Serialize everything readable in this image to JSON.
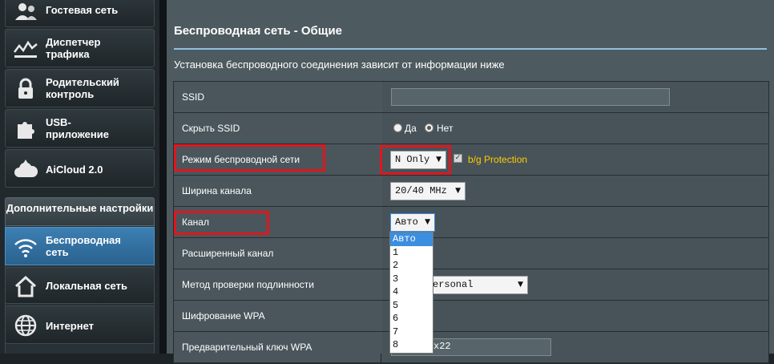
{
  "sidebar": {
    "items": [
      {
        "label": "Гостевая сеть",
        "icon": "guest-network-icon"
      },
      {
        "label": "Диспетчер трафика",
        "icon": "traffic-manager-icon"
      },
      {
        "label": "Родительский контроль",
        "icon": "lock-icon"
      },
      {
        "label": "USB-приложение",
        "icon": "puzzle-icon"
      },
      {
        "label": "AiCloud 2.0",
        "icon": "cloud-icon"
      }
    ],
    "advanced_header": "Дополнительные настройки",
    "advanced_items": [
      {
        "label": "Беспроводная сеть",
        "icon": "wifi-icon",
        "active": true
      },
      {
        "label": "Локальная сеть",
        "icon": "home-icon"
      },
      {
        "label": "Интернет",
        "icon": "globe-icon"
      }
    ]
  },
  "main": {
    "title": "Беспроводная сеть - Общие",
    "description": "Установка беспроводного соединения зависит от информации ниже",
    "fields": {
      "ssid": {
        "label": "SSID",
        "value": ""
      },
      "hide_ssid": {
        "label": "Скрыть SSID",
        "options": [
          "Да",
          "Нет"
        ],
        "selected": "Нет"
      },
      "wireless_mode": {
        "label": "Режим беспроводной сети",
        "value": "N Only",
        "protection_label": "b/g Protection",
        "protection_checked": true
      },
      "channel_width": {
        "label": "Ширина канала",
        "value": "20/40 MHz"
      },
      "channel": {
        "label": "Канал",
        "value": "Авто",
        "options": [
          "Авто",
          "1",
          "2",
          "3",
          "4",
          "5",
          "6",
          "7",
          "8"
        ],
        "selected": "Авто"
      },
      "extended_channel": {
        "label": "Расширенный канал"
      },
      "auth_method": {
        "label": "Метод проверки подлинности",
        "value_visible": "ersonal"
      },
      "wpa_encryption": {
        "label": "Шифрование WPA"
      },
      "wpa_key": {
        "label": "Предварительный ключ WPA",
        "value_visible": "x22"
      }
    }
  },
  "colors": {
    "highlight": "#e0161e",
    "accent": "#3b8ee0",
    "protection_text": "#ffcc00"
  }
}
